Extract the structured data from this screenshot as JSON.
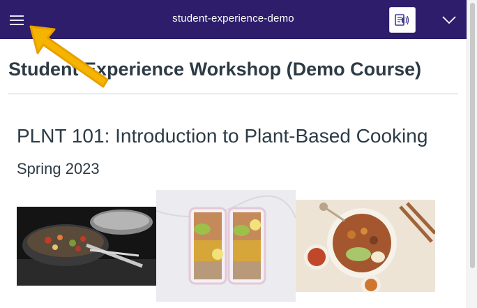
{
  "topbar": {
    "course_title": "student-experience-demo",
    "menu_icon": "hamburger-menu-icon",
    "immersive_reader_icon": "immersive-reader-icon",
    "expand_icon": "chevron-down-icon"
  },
  "page": {
    "heading": "Student Experience Workshop (Demo Course)",
    "course_name": "PLNT 101: Introduction to Plant-Based Cooking",
    "term": "Spring 2023"
  },
  "images": [
    {
      "name": "wok-stir-fry-photo"
    },
    {
      "name": "meal-prep-containers-photo"
    },
    {
      "name": "plant-based-bowl-photo"
    }
  ],
  "colors": {
    "topbar": "#2d1d6b",
    "text": "#2d3b45",
    "annotation_arrow": "#f5b400"
  }
}
